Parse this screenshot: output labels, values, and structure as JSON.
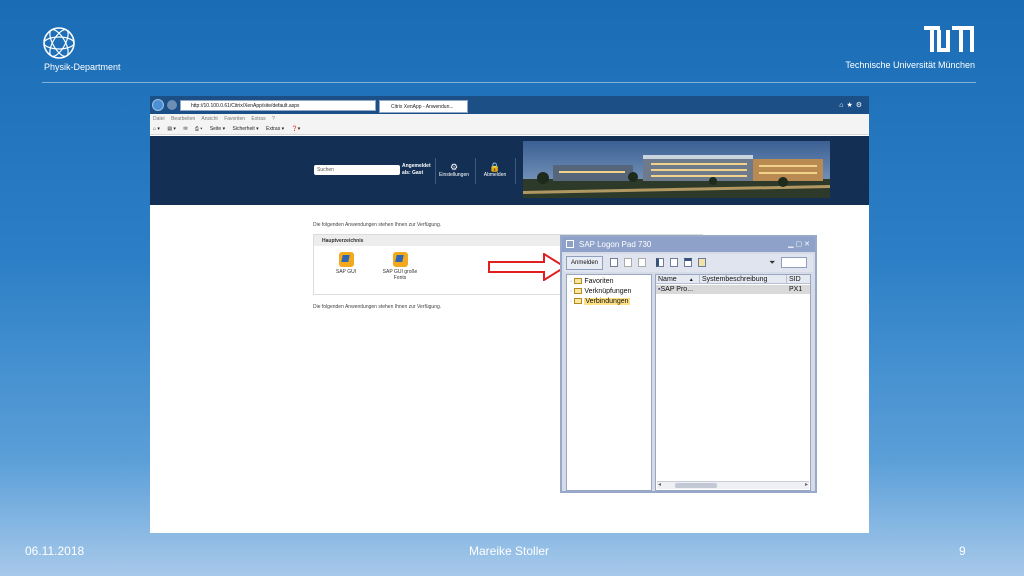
{
  "slide": {
    "department": "Physik-Department",
    "university": "Technische Universität München",
    "footer_date": "06.11.2018",
    "footer_author": "Mareike Stoller",
    "footer_page": "9"
  },
  "browser": {
    "address": "http://10.100.0.61/Citrix/XenApp/site/default.aspx",
    "tab_title": "Citrix XenApp - Anwendun...",
    "menu": [
      "Datei",
      "Bearbeiten",
      "Ansicht",
      "Favoriten",
      "Extras",
      "?"
    ],
    "commands": [
      "Seite ▾",
      "Sicherheit ▾",
      "Extras ▾"
    ]
  },
  "citrix": {
    "search_placeholder": "Suchen",
    "user_line1": "Angemeldet",
    "user_line2": "als: Gast",
    "settings_label": "Einstellungen",
    "logout_label": "Abmelden",
    "available_text": "Die folgenden Anwendungen stehen Ihnen zur Verfügung.",
    "folder_title": "Hauptverzeichnis",
    "apps": [
      {
        "name": "SAP GUI"
      },
      {
        "name": "SAP GUI große Fonts"
      }
    ]
  },
  "sap_logon": {
    "title": "SAP Logon Pad 730",
    "logon_button": "Anmelden",
    "tree": [
      "Favoriten",
      "Verknüpfungen",
      "Verbindungen"
    ],
    "selected_tree_item": "Verbindungen",
    "columns": [
      "Name",
      "Systembeschreibung",
      "SID"
    ],
    "rows": [
      {
        "name": "SAP Pro...",
        "description": "",
        "sid": "PX1"
      }
    ]
  },
  "colors": {
    "slide_blue": "#1a6cb4",
    "citrix_header": "#132f54",
    "arrow_red": "#e02020",
    "sap_title": "#8ea1c9"
  }
}
